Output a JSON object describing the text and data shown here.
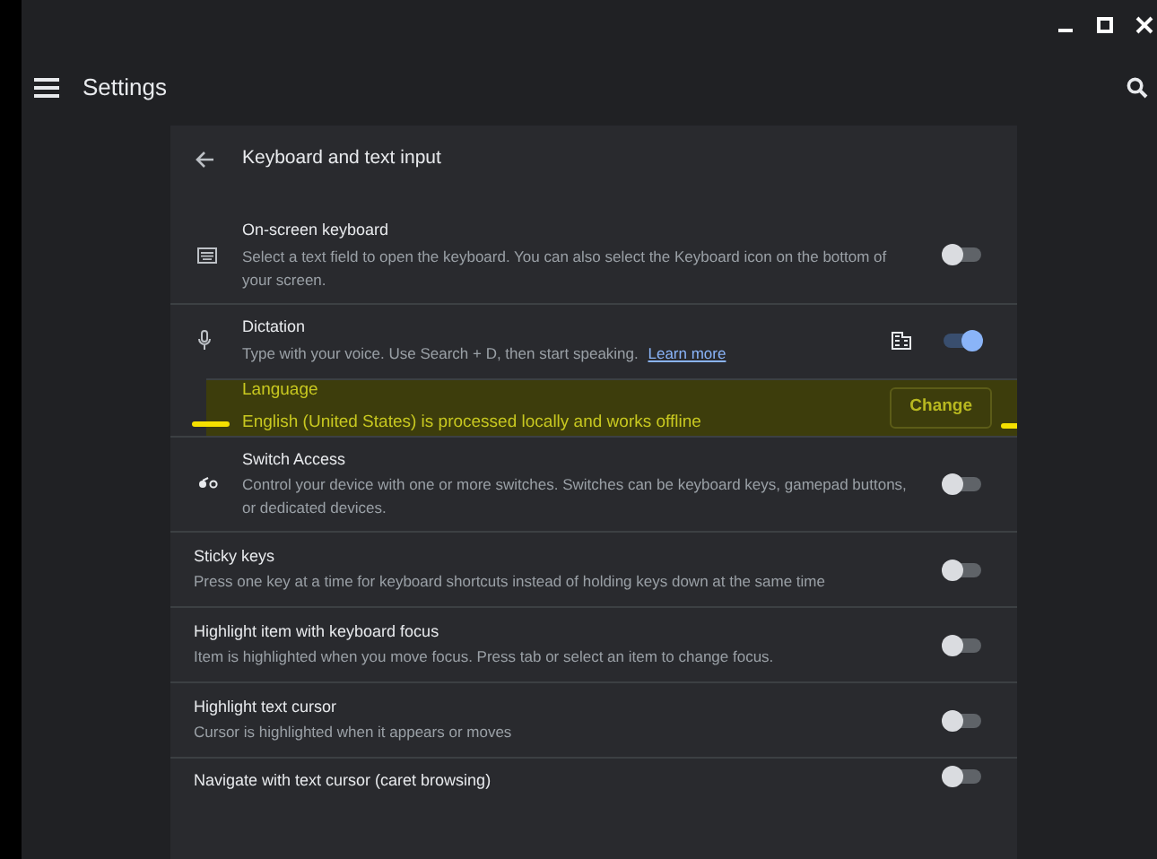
{
  "window": {
    "title": "Settings"
  },
  "page": {
    "title": "Keyboard and text input"
  },
  "rows": [
    {
      "kind": "toggle",
      "title": "On-screen keyboard",
      "description": "Select a text field to open the keyboard. You can also select the Keyboard icon on the bottom of your screen.",
      "on": false
    },
    {
      "kind": "toggle",
      "title": "Dictation",
      "description": "Type with your voice. Use Search + D, then start speaking.",
      "link": "Learn more",
      "on": true
    },
    {
      "kind": "sub",
      "title": "Language",
      "description": "English (United States) is processed locally and works offline",
      "button": "Change",
      "highlighted": true
    },
    {
      "kind": "toggle",
      "title": "Switch Access",
      "description": "Control your device with one or more switches. Switches can be keyboard keys, gamepad buttons, or dedicated devices.",
      "on": false
    },
    {
      "kind": "toggle",
      "title": "Sticky keys",
      "description": "Press one key at a time for keyboard shortcuts instead of holding keys down at the same time",
      "on": false
    },
    {
      "kind": "toggle",
      "title": "Highlight item with keyboard focus",
      "description": "Item is highlighted when you move focus. Press tab or select an item to change focus.",
      "on": false
    },
    {
      "kind": "toggle",
      "title": "Highlight text cursor",
      "description": "Cursor is highlighted when it appears or moves",
      "on": false
    },
    {
      "kind": "toggle",
      "title": "Navigate with text cursor (caret browsing)",
      "on": false
    }
  ]
}
